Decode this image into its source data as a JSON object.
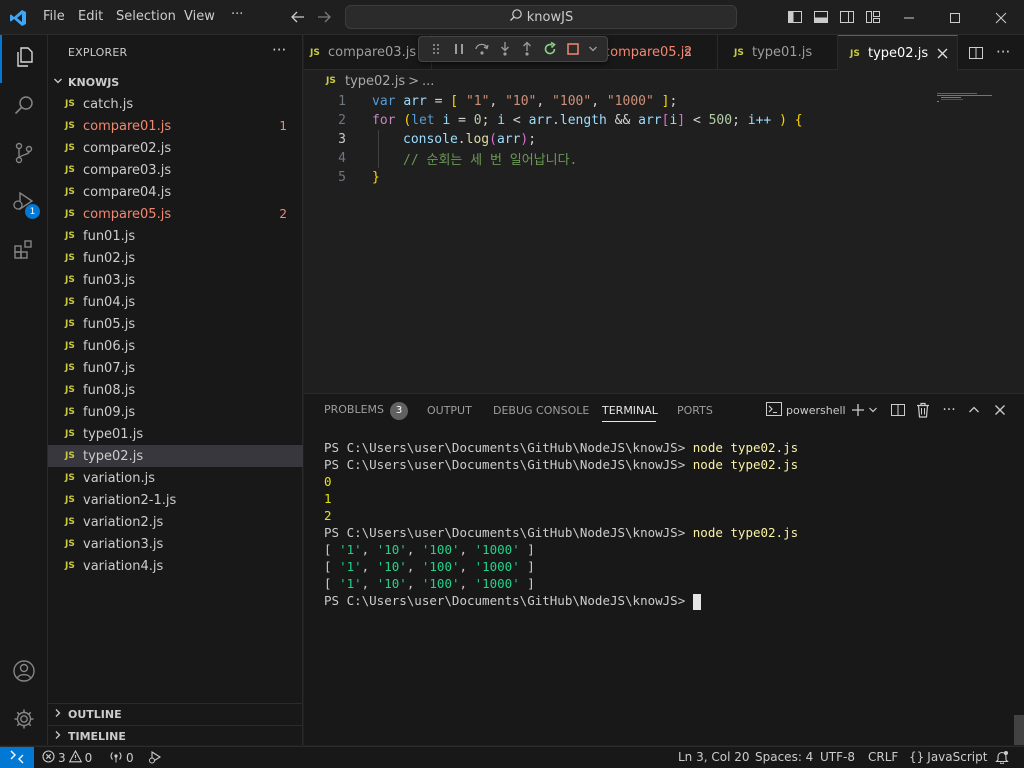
{
  "titlebar": {
    "menus": [
      "File",
      "Edit",
      "Selection",
      "View",
      "···"
    ],
    "search_text": "knowJS"
  },
  "activity": {
    "debug_badge": "1"
  },
  "sidebar": {
    "title": "EXPLORER",
    "more": "···",
    "folder": "KNOWJS",
    "files": [
      {
        "name": "catch.js",
        "error": false,
        "count": ""
      },
      {
        "name": "compare01.js",
        "error": true,
        "count": "1"
      },
      {
        "name": "compare02.js",
        "error": false,
        "count": ""
      },
      {
        "name": "compare03.js",
        "error": false,
        "count": ""
      },
      {
        "name": "compare04.js",
        "error": false,
        "count": ""
      },
      {
        "name": "compare05.js",
        "error": true,
        "count": "2"
      },
      {
        "name": "fun01.js",
        "error": false,
        "count": ""
      },
      {
        "name": "fun02.js",
        "error": false,
        "count": ""
      },
      {
        "name": "fun03.js",
        "error": false,
        "count": ""
      },
      {
        "name": "fun04.js",
        "error": false,
        "count": ""
      },
      {
        "name": "fun05.js",
        "error": false,
        "count": ""
      },
      {
        "name": "fun06.js",
        "error": false,
        "count": ""
      },
      {
        "name": "fun07.js",
        "error": false,
        "count": ""
      },
      {
        "name": "fun08.js",
        "error": false,
        "count": ""
      },
      {
        "name": "fun09.js",
        "error": false,
        "count": ""
      },
      {
        "name": "type01.js",
        "error": false,
        "count": ""
      },
      {
        "name": "type02.js",
        "error": false,
        "count": "",
        "selected": true
      },
      {
        "name": "variation.js",
        "error": false,
        "count": ""
      },
      {
        "name": "variation2-1.js",
        "error": false,
        "count": ""
      },
      {
        "name": "variation2.js",
        "error": false,
        "count": ""
      },
      {
        "name": "variation3.js",
        "error": false,
        "count": ""
      },
      {
        "name": "variation4.js",
        "error": false,
        "count": ""
      }
    ],
    "js_label": "JS",
    "outline": "OUTLINE",
    "timeline": "TIMELINE"
  },
  "tabs": [
    {
      "label": "compare03.js",
      "count": ""
    },
    {
      "label": "compare05.js",
      "count": "2"
    },
    {
      "label": "type01.js",
      "count": ""
    },
    {
      "label": "type02.js",
      "count": "",
      "active": true
    }
  ],
  "breadcrumb": {
    "file": "type02.js",
    "sep": ">",
    "rest": "..."
  },
  "editor": {
    "line_numbers": [
      "1",
      "2",
      "3",
      "4",
      "5"
    ],
    "current_line": 3,
    "line1": {
      "kw": "var",
      "name": "arr",
      "eq": " = ",
      "open": "[",
      "s1": "\"1\"",
      "s2": "\"10\"",
      "s3": "\"100\"",
      "s4": "\"1000\"",
      "close": "]",
      "semi": ";"
    },
    "line2": {
      "kw": "for",
      "let": "let",
      "i": "i",
      "zero": "0",
      "lt": " < ",
      "arr_length": "arr.length",
      "and": " && ",
      "arr": "arr",
      "idx_i": "i",
      "limit": "500",
      "inc": "i++"
    },
    "line3": {
      "obj": "console",
      "fn": "log",
      "arg": "arr"
    },
    "line4": {
      "comment": "// 순회는 세 번 일어납니다."
    },
    "line5": {
      "close": "}"
    }
  },
  "panel": {
    "tabs": [
      "PROBLEMS",
      "OUTPUT",
      "DEBUG CONSOLE",
      "TERMINAL",
      "PORTS"
    ],
    "problems_count": "3",
    "active_tab": "TERMINAL",
    "shell": "powershell",
    "terminal": {
      "prompt": "PS C:\\Users\\user\\Documents\\GitHub\\NodeJS\\knowJS>",
      "command": "node type02.js",
      "numbers": [
        "0",
        "1",
        "2"
      ],
      "array_items": [
        "'1'",
        "'10'",
        "'100'",
        "'1000'"
      ]
    }
  },
  "statusbar": {
    "errors": "3",
    "warnings": "0",
    "ports": "0",
    "position": "Ln 3, Col 20",
    "spaces": "Spaces: 4",
    "encoding": "UTF-8",
    "eol": "CRLF",
    "language_brackets": "{}",
    "language": "JavaScript"
  },
  "colors": {
    "accent": "#0078d4",
    "error": "#f48771",
    "js_icon": "#cbcb41"
  }
}
